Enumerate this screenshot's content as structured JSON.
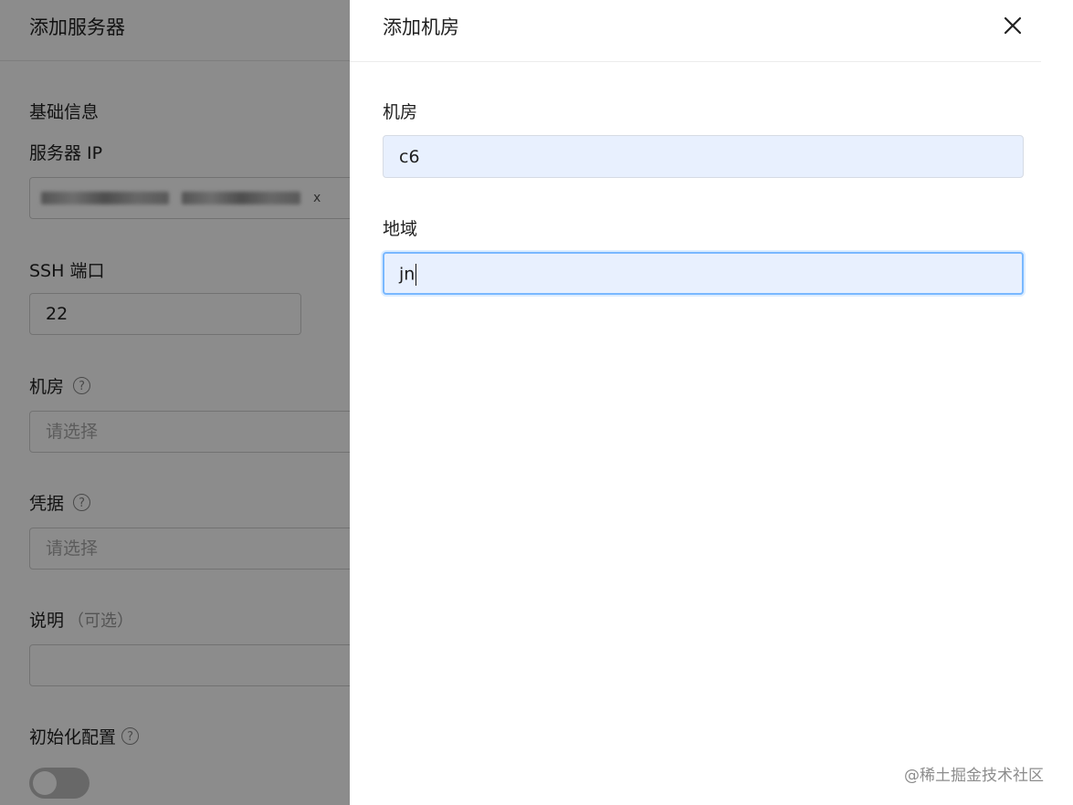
{
  "base_form": {
    "title": "添加服务器",
    "section_title": "基础信息",
    "server_ip_label": "服务器 IP",
    "chip_remove": "x",
    "ssh_port_label": "SSH 端口",
    "ssh_port_value": "22",
    "room_label": "机房",
    "room_placeholder": "请选择",
    "credential_label": "凭据",
    "credential_placeholder": "请选择",
    "description_label": "说明",
    "description_optional": "（可选）",
    "init_config_label": "初始化配置",
    "help_glyph": "?"
  },
  "drawer": {
    "title": "添加机房",
    "close_icon": "close-icon",
    "room_label": "机房",
    "room_value": "c6",
    "region_label": "地域",
    "region_value": "jn"
  },
  "watermark": "@稀土掘金技术社区",
  "colors": {
    "input_bg": "#e8f0fe",
    "focus_border": "#79b8ff",
    "overlay": "rgba(0,0,0,0.45)"
  }
}
